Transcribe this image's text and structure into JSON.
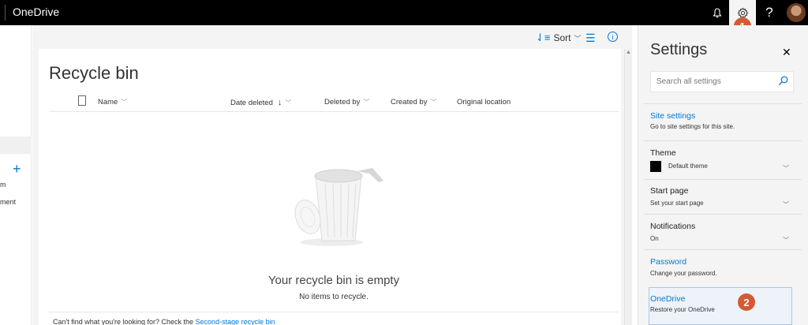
{
  "topbar": {
    "app_name": "OneDrive",
    "help_label": "?"
  },
  "badges": {
    "step1": "1",
    "step2": "2"
  },
  "leftnav": {
    "text1": "m",
    "text2": "ment"
  },
  "commandbar": {
    "sort_label": "Sort"
  },
  "page": {
    "title": "Recycle bin"
  },
  "columns": {
    "name": "Name",
    "date_deleted": "Date deleted",
    "deleted_by": "Deleted by",
    "created_by": "Created by",
    "original_location": "Original location"
  },
  "empty": {
    "title": "Your recycle bin is empty",
    "subtitle": "No items to recycle."
  },
  "footer": {
    "text": "Can't find what you're looking for? Check the ",
    "link": "Second-stage recycle bin"
  },
  "settings": {
    "title": "Settings",
    "search_placeholder": "Search all settings",
    "site_settings": {
      "label": "Site settings",
      "desc": "Go to site settings for this site."
    },
    "theme": {
      "label": "Theme",
      "value": "Default theme",
      "swatch_color": "#000000"
    },
    "start_page": {
      "label": "Start page",
      "desc": "Set your start page"
    },
    "notifications": {
      "label": "Notifications",
      "value": "On"
    },
    "password": {
      "label": "Password",
      "desc": "Change your password."
    },
    "onedrive": {
      "label": "OneDrive",
      "desc": "Restore your OneDrive"
    }
  },
  "colors": {
    "accent": "#0078d4",
    "badge": "#d35a33",
    "topbar": "#000000"
  }
}
